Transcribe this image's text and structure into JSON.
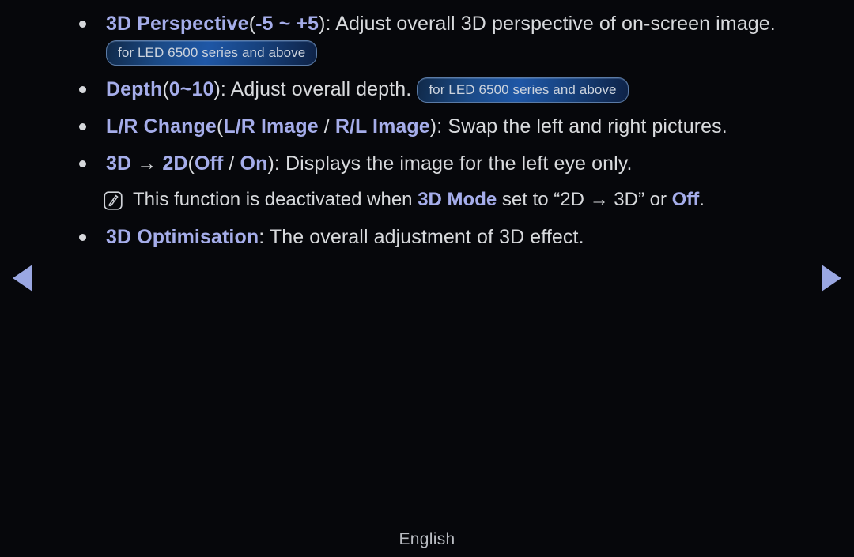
{
  "page": {
    "background_color": "#06070b",
    "accent_color": "#a5adea",
    "text_color": "#d8dadd",
    "badge_border_color": "#5b7ba6",
    "arrow_color": "#9aa7e2"
  },
  "items": [
    {
      "id": "3d-perspective",
      "term": "3D Perspective",
      "range_open": "(",
      "range": "-5 ~ +5",
      "range_close": ")",
      "colon": ": ",
      "description": "Adjust overall 3D perspective of on-screen image.",
      "badge": "for LED 6500 series and above"
    },
    {
      "id": "depth",
      "term": "Depth",
      "range_open": "(",
      "range": "0~10",
      "range_close": ")",
      "colon": ": ",
      "description": "Adjust overall depth.",
      "badge": "for LED 6500 series and above"
    },
    {
      "id": "lr-change",
      "term": "L/R Change",
      "range_open": "(",
      "option_a": "L/R Image",
      "option_sep": " / ",
      "option_b": "R/L Image",
      "range_close": ")",
      "colon": ": ",
      "description": "Swap the left and right pictures."
    },
    {
      "id": "3d-to-2d",
      "term_a": "3D",
      "term_arrow": "→",
      "term_b": "2D",
      "range_open": "(",
      "option_a": "Off",
      "option_sep": " / ",
      "option_b": "On",
      "range_close": ")",
      "colon": ": ",
      "description": "Displays the image for the left eye only."
    },
    {
      "id": "3d-optimisation",
      "term": "3D Optimisation",
      "colon": ": ",
      "description": "The overall adjustment of 3D effect."
    }
  ],
  "note": {
    "icon": "note-pencil-icon",
    "text_before": "This function is deactivated when ",
    "emphasis_1": "3D Mode",
    "text_middle": " set to “2D → 3D” or ",
    "emphasis_2": "Off",
    "text_after": "."
  },
  "navigation": {
    "prev_label": "previous-page",
    "prev_icon": "triangle-left-icon",
    "next_label": "next-page",
    "next_icon": "triangle-right-icon"
  },
  "footer": {
    "language": "English"
  }
}
